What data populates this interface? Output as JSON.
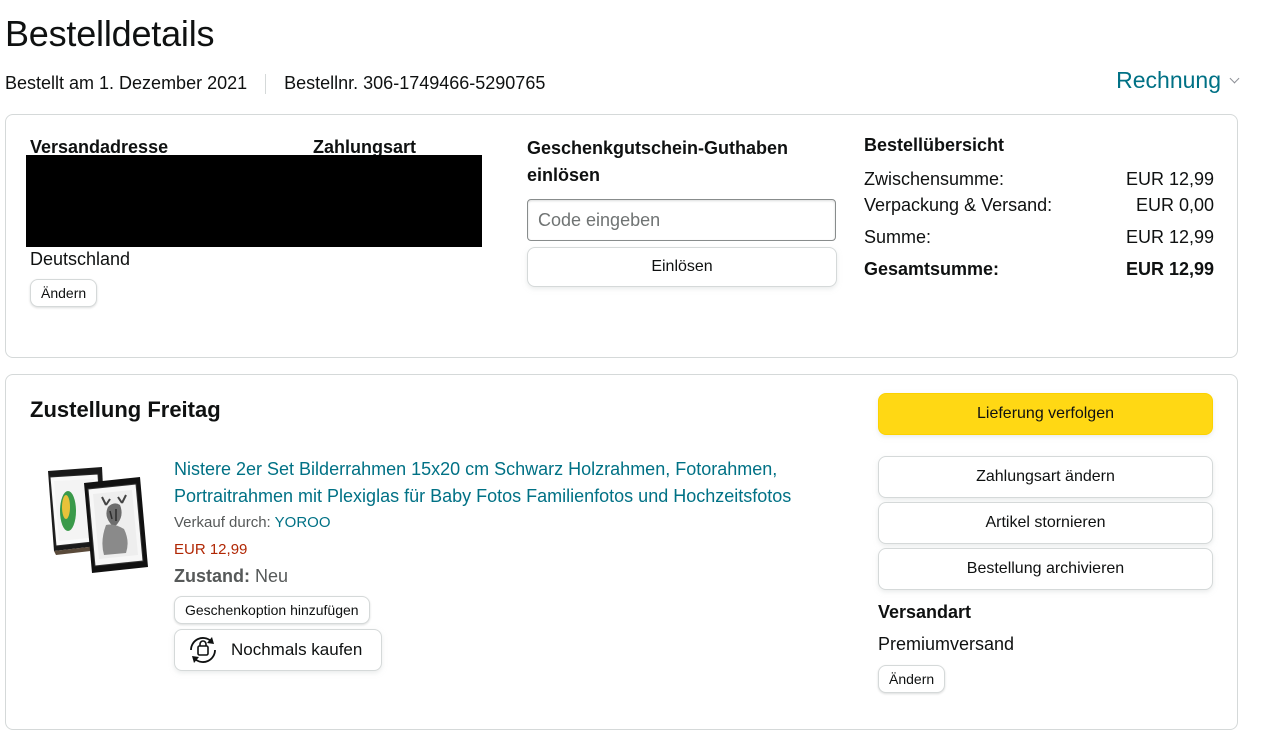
{
  "header": {
    "title": "Bestelldetails",
    "order_date": "Bestellt am 1. Dezember 2021",
    "order_number": "Bestellnr. 306-1749466-5290765",
    "invoice_label": "Rechnung"
  },
  "order_info": {
    "shipping_address_label": "Versandadresse",
    "payment_method_label": "Zahlungsart",
    "country": "Deutschland",
    "change_label": "Ändern",
    "gift_card": {
      "heading": "Geschenkgutschein-Guthaben einlösen",
      "input_placeholder": "Code eingeben",
      "input_value": "",
      "redeem_label": "Einlösen"
    },
    "summary": {
      "title": "Bestellübersicht",
      "rows": [
        {
          "label": "Zwischensumme:",
          "value": "EUR 12,99"
        },
        {
          "label": "Verpackung & Versand:",
          "value": "EUR 0,00"
        },
        {
          "label": "Summe:",
          "value": "EUR 12,99"
        }
      ],
      "total": {
        "label": "Gesamtsumme:",
        "value": "EUR 12,99"
      }
    }
  },
  "shipment": {
    "title": "Zustellung Freitag",
    "product": {
      "name": "Nistere 2er Set Bilderrahmen 15x20 cm Schwarz Holzrahmen, Fotorahmen, Portraitrahmen mit Plexiglas für Baby Fotos Familienfotos und Hochzeitsfotos",
      "seller_prefix": "Verkauf durch:",
      "seller": "YOROO",
      "price": "EUR 12,99",
      "condition_label": "Zustand:",
      "condition_value": "Neu",
      "gift_option_label": "Geschenkoption hinzufügen",
      "buy_again_label": "Nochmals kaufen"
    },
    "actions": {
      "track": "Lieferung verfolgen",
      "change_payment": "Zahlungsart ändern",
      "cancel": "Artikel stornieren",
      "archive": "Bestellung archivieren"
    },
    "shipping_method_label": "Versandart",
    "shipping_method_value": "Premiumversand",
    "change_label": "Ändern"
  },
  "colors": {
    "link": "#007185",
    "price": "#B12704",
    "primary_button": "#FFD814",
    "border": "#D5D9D9"
  }
}
